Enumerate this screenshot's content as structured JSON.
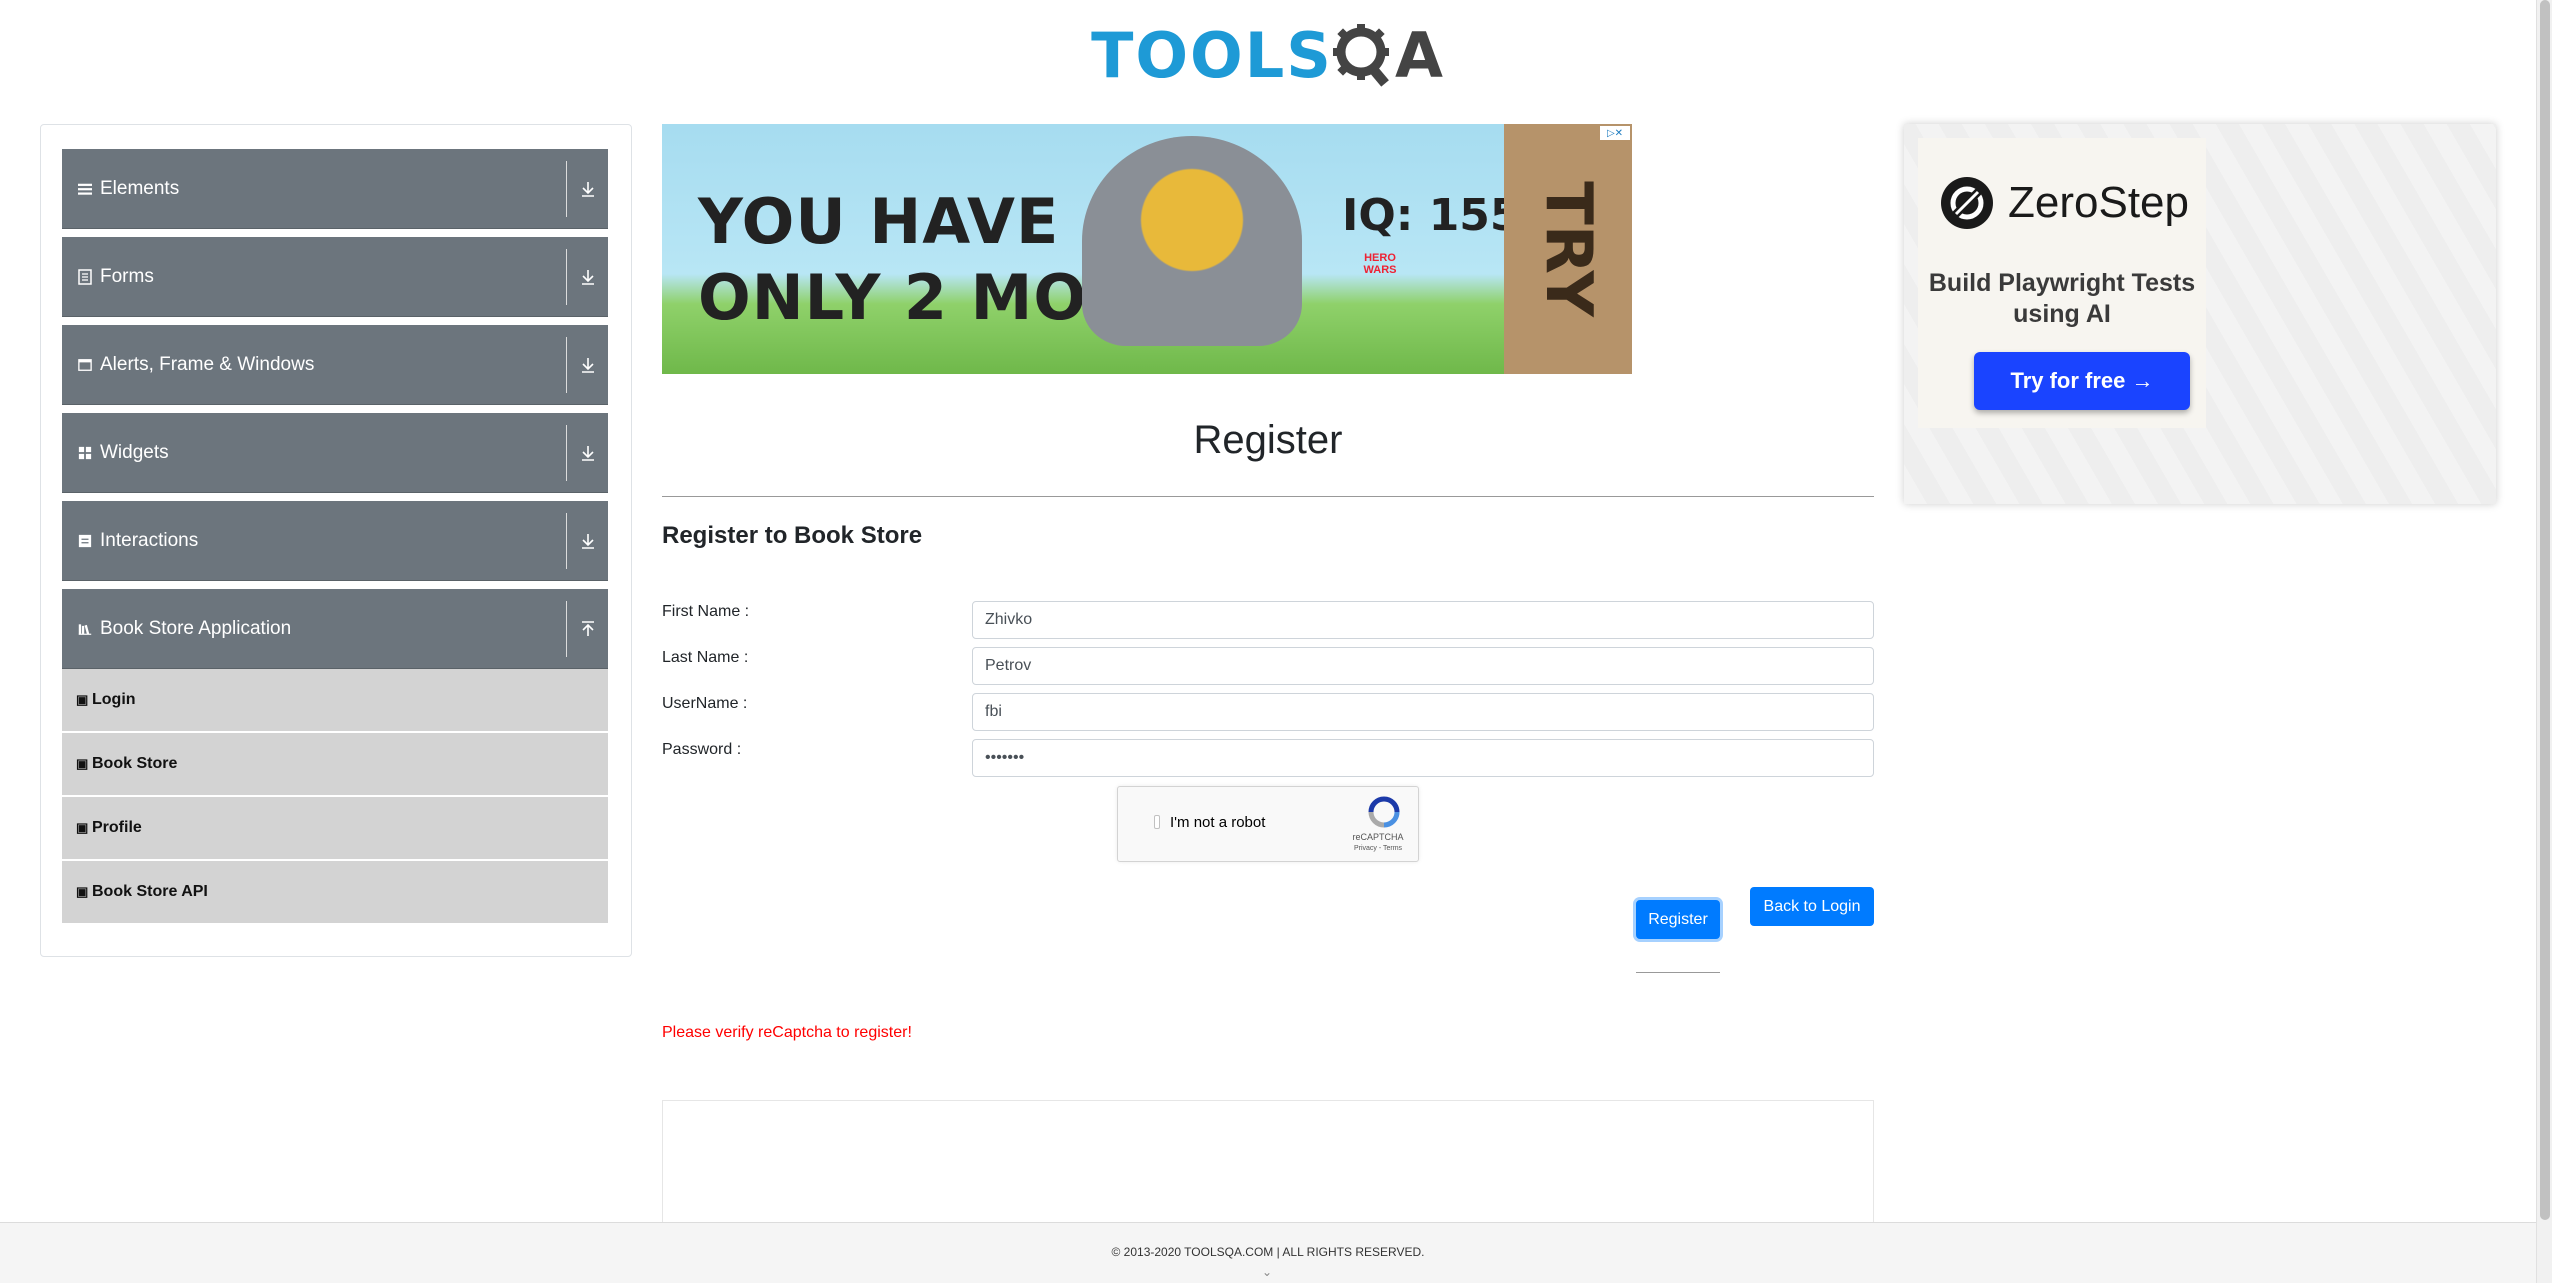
{
  "header": {
    "logo_tools": "TOOLS",
    "logo_qa": "QA"
  },
  "sidebar": {
    "groups": [
      {
        "label": "Elements",
        "icon": "hamburger-icon"
      },
      {
        "label": "Forms",
        "icon": "document-icon"
      },
      {
        "label": "Alerts, Frame & Windows",
        "icon": "window-icon"
      },
      {
        "label": "Widgets",
        "icon": "grid-icon"
      },
      {
        "label": "Interactions",
        "icon": "interactions-icon"
      },
      {
        "label": "Book Store Application",
        "icon": "books-icon"
      }
    ],
    "items": [
      {
        "label": "Login"
      },
      {
        "label": "Book Store"
      },
      {
        "label": "Profile"
      },
      {
        "label": "Book Store API"
      }
    ]
  },
  "ad_banner": {
    "line1": "YOU HAVE",
    "line2": "ONLY 2 MOVES",
    "iq": "IQ: 155",
    "cta": "TRY",
    "brand": "HERO WARS"
  },
  "main": {
    "title": "Register",
    "subtitle": "Register to Book Store",
    "fields": {
      "first_name": {
        "label": "First Name :",
        "value": "Zhivko"
      },
      "last_name": {
        "label": "Last Name :",
        "value": "Petrov"
      },
      "username": {
        "label": "UserName :",
        "value": "fbi"
      },
      "password": {
        "label": "Password :",
        "value": "•••••••"
      }
    },
    "captcha": {
      "label": "I'm not a robot",
      "brand": "reCAPTCHA",
      "terms": "Privacy - Terms"
    },
    "register_button": "Register",
    "back_button": "Back to Login",
    "error": "Please verify reCaptcha to register!"
  },
  "right_ad": {
    "brand": "ZeroStep",
    "tagline": "Build Playwright Tests using AI",
    "cta": "Try for free →"
  },
  "footer": {
    "text": "© 2013-2020 TOOLSQA.COM | ALL RIGHTS RESERVED."
  },
  "colors": {
    "accent": "#007bff",
    "sidebar_group": "#6c757d",
    "sidebar_item": "#d3d3d3",
    "error": "#ff0000",
    "logo_blue": "#1e9ad6"
  }
}
